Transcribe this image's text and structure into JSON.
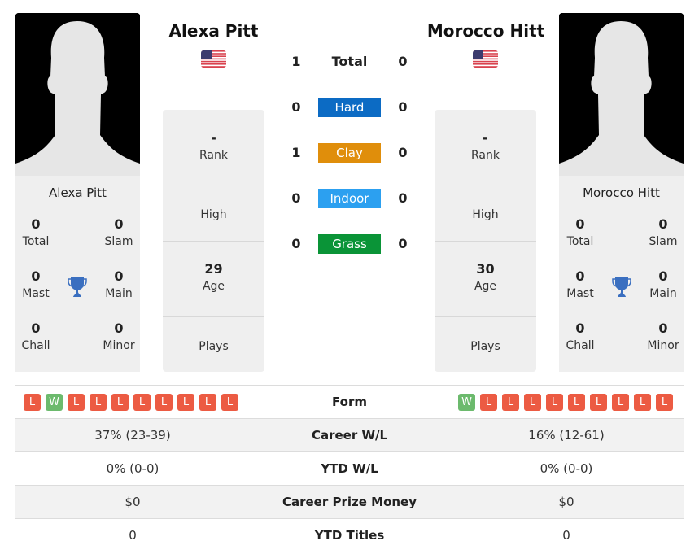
{
  "player1": {
    "name": "Alexa Pitt",
    "flag": "us-flag",
    "card_name": "Alexa Pitt",
    "titles": {
      "total": {
        "value": "0",
        "label": "Total"
      },
      "slam": {
        "value": "0",
        "label": "Slam"
      },
      "mast": {
        "value": "0",
        "label": "Mast"
      },
      "main": {
        "value": "0",
        "label": "Main"
      },
      "chall": {
        "value": "0",
        "label": "Chall"
      },
      "minor": {
        "value": "0",
        "label": "Minor"
      }
    },
    "rank": {
      "value": "-",
      "label": "Rank"
    },
    "high": {
      "value": "",
      "label": "High"
    },
    "age": {
      "value": "29",
      "label": "Age"
    },
    "plays": {
      "value": "",
      "label": "Plays"
    },
    "form": [
      "L",
      "W",
      "L",
      "L",
      "L",
      "L",
      "L",
      "L",
      "L",
      "L"
    ],
    "career_wl": "37% (23-39)",
    "ytd_wl": "0% (0-0)",
    "prize_money": "$0",
    "ytd_titles": "0"
  },
  "player2": {
    "name": "Morocco Hitt",
    "flag": "us-flag",
    "card_name": "Morocco Hitt",
    "titles": {
      "total": {
        "value": "0",
        "label": "Total"
      },
      "slam": {
        "value": "0",
        "label": "Slam"
      },
      "mast": {
        "value": "0",
        "label": "Mast"
      },
      "main": {
        "value": "0",
        "label": "Main"
      },
      "chall": {
        "value": "0",
        "label": "Chall"
      },
      "minor": {
        "value": "0",
        "label": "Minor"
      }
    },
    "rank": {
      "value": "-",
      "label": "Rank"
    },
    "high": {
      "value": "",
      "label": "High"
    },
    "age": {
      "value": "30",
      "label": "Age"
    },
    "plays": {
      "value": "",
      "label": "Plays"
    },
    "form": [
      "W",
      "L",
      "L",
      "L",
      "L",
      "L",
      "L",
      "L",
      "L",
      "L"
    ],
    "career_wl": "16% (12-61)",
    "ytd_wl": "0% (0-0)",
    "prize_money": "$0",
    "ytd_titles": "0"
  },
  "h2h": {
    "total": {
      "label": "Total",
      "p1": "1",
      "p2": "0"
    },
    "surfaces": [
      {
        "label": "Hard",
        "p1": "0",
        "p2": "0",
        "color": "#0c6bc4"
      },
      {
        "label": "Clay",
        "p1": "1",
        "p2": "0",
        "color": "#e08e0b"
      },
      {
        "label": "Indoor",
        "p1": "0",
        "p2": "0",
        "color": "#2ca0f0"
      },
      {
        "label": "Grass",
        "p1": "0",
        "p2": "0",
        "color": "#0a9437"
      }
    ]
  },
  "comparison": {
    "form_label": "Form",
    "career_wl_label": "Career W/L",
    "ytd_wl_label": "YTD W/L",
    "prize_money_label": "Career Prize Money",
    "ytd_titles_label": "YTD Titles"
  },
  "colors": {
    "loss": "#ec5b43",
    "win": "#6cba6d",
    "trophy": "#3a6fc0"
  }
}
